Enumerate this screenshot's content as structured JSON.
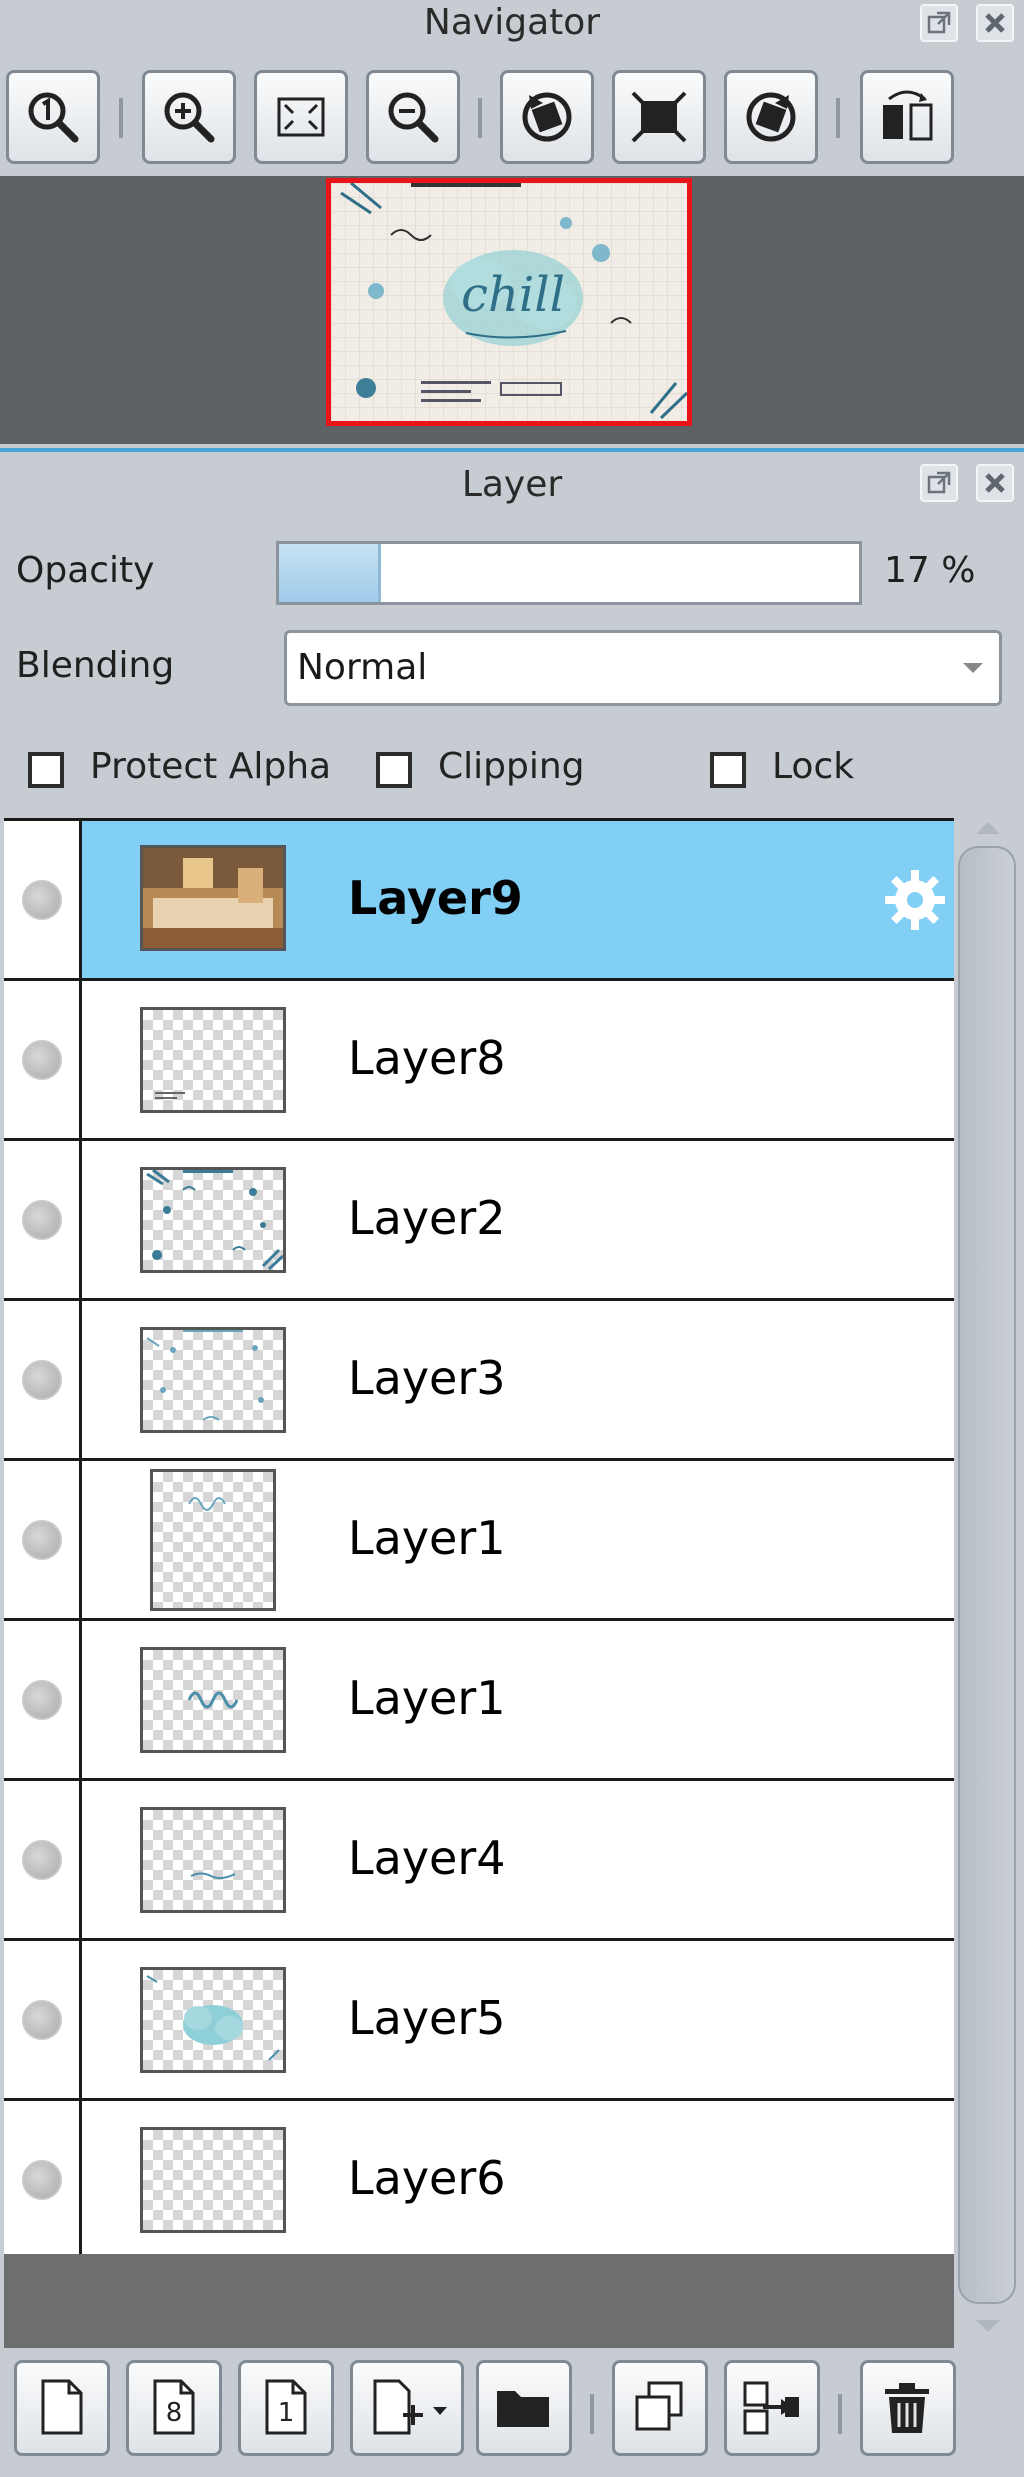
{
  "navigator": {
    "title": "Navigator",
    "tools": [
      "zoom-actual-size-icon",
      "zoom-in-icon",
      "fit-window-icon",
      "zoom-out-icon",
      "rotate-left-icon",
      "reset-view-icon",
      "rotate-right-icon",
      "flip-horizontal-icon"
    ],
    "preview_text": "chill"
  },
  "layer_panel": {
    "title": "Layer",
    "opacity_label": "Opacity",
    "opacity_value": 17,
    "opacity_text": "17 %",
    "blending_label": "Blending",
    "blending_value": "Normal",
    "checkboxes": [
      {
        "label": "Protect Alpha",
        "checked": false
      },
      {
        "label": "Clipping",
        "checked": false
      },
      {
        "label": "Lock",
        "checked": false
      }
    ],
    "layers": [
      {
        "name": "Layer9",
        "selected": true,
        "thumb": "photo"
      },
      {
        "name": "Layer8",
        "selected": false,
        "thumb": "text-bottom-left"
      },
      {
        "name": "Layer2",
        "selected": false,
        "thumb": "border-doodles"
      },
      {
        "name": "Layer3",
        "selected": false,
        "thumb": "border-doodles-light"
      },
      {
        "name": "Layer1",
        "selected": false,
        "thumb": "portrait-lettering"
      },
      {
        "name": "Layer1",
        "selected": false,
        "thumb": "lettering"
      },
      {
        "name": "Layer4",
        "selected": false,
        "thumb": "squiggle"
      },
      {
        "name": "Layer5",
        "selected": false,
        "thumb": "cloud"
      },
      {
        "name": "Layer6",
        "selected": false,
        "thumb": "empty"
      }
    ],
    "bottom_tools": [
      "new-layer-icon",
      "new-8bit-layer-icon",
      "new-1bit-layer-icon",
      "add-layer-menu-icon",
      "new-folder-icon",
      "duplicate-layer-icon",
      "merge-down-icon",
      "delete-layer-icon"
    ]
  },
  "colors": {
    "selected_row": "#81cff5",
    "panel_bg": "#c6ccd2",
    "accent_divider": "#4aa5d6",
    "navigator_frame": "#e8141a"
  }
}
